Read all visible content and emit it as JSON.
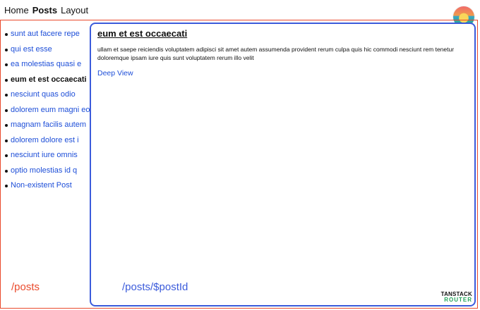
{
  "topnav": {
    "items": [
      {
        "label": "Home"
      },
      {
        "label": "Posts"
      },
      {
        "label": "Layout"
      }
    ]
  },
  "posts": {
    "items": [
      {
        "label": "sunt aut facere repe"
      },
      {
        "label": "qui est esse"
      },
      {
        "label": "ea molestias quasi e"
      },
      {
        "label": "eum et est occaecati"
      },
      {
        "label": "nesciunt quas odio"
      },
      {
        "label": "dolorem eum magni eo"
      },
      {
        "label": "magnam facilis autem"
      },
      {
        "label": "dolorem dolore est i"
      },
      {
        "label": "nesciunt iure omnis"
      },
      {
        "label": "optio molestias id q"
      },
      {
        "label": "Non-existent Post"
      }
    ],
    "route_label": "/posts"
  },
  "post": {
    "title": "eum et est occaecati",
    "body": "ullam et saepe reiciendis voluptatem adipisci sit amet autem assumenda provident rerum culpa quis hic commodi nesciunt rem tenetur doloremque ipsam iure quis sunt voluptatem rerum illo velit",
    "deep_view_label": "Deep View",
    "route_label": "/posts/$postId"
  },
  "brand": {
    "line1": "TANSTACK",
    "line2": "ROUTER"
  },
  "colors": {
    "posts_frame": "#ea4a2c",
    "post_frame": "#3b5bdb",
    "link": "#1d4ed8"
  }
}
